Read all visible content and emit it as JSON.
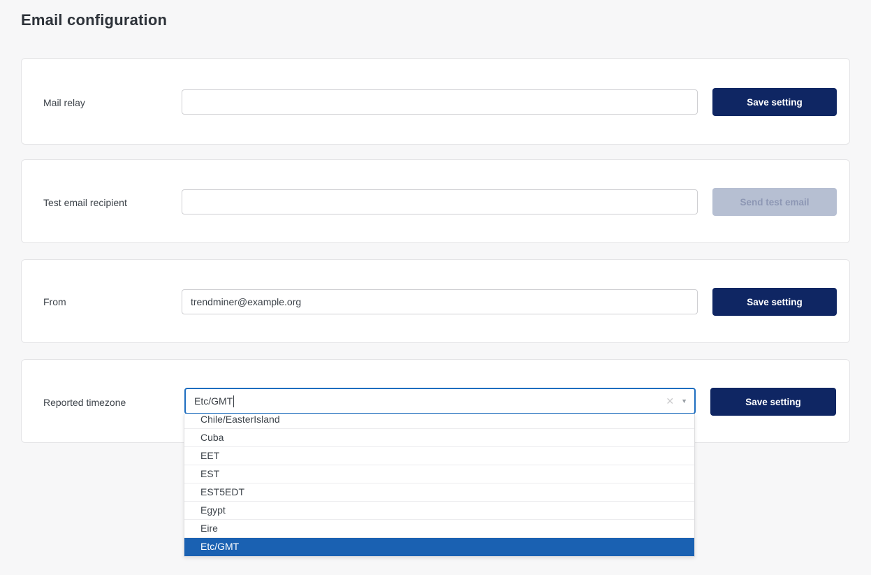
{
  "title": "Email configuration",
  "cards": [
    {
      "label": "Mail relay",
      "value": "",
      "button": "Save setting",
      "disabled": false
    },
    {
      "label": "Test email recipient",
      "value": "",
      "button": "Send test email",
      "disabled": true
    },
    {
      "label": "From",
      "value": "trendminer@example.org",
      "button": "Save setting",
      "disabled": false
    },
    {
      "label": "Reported timezone",
      "value": "Etc/GMT",
      "button": "Save setting",
      "disabled": false
    }
  ],
  "timezone_dropdown": {
    "items": [
      "Chile/EasterIsland",
      "Cuba",
      "EET",
      "EST",
      "EST5EDT",
      "Egypt",
      "Eire",
      "Etc/GMT"
    ],
    "highlighted_item": "Etc/GMT",
    "clear_icon": "✕",
    "caret_icon": "▼"
  },
  "colors": {
    "page_background": "#f7f7f8",
    "primary_button": "#0f2663",
    "disabled_button_bg": "#b6bfd2",
    "disabled_button_text": "#8d97b4",
    "combobox_focus_border": "#1e6ec0",
    "dropdown_highlight": "#1a61b2"
  }
}
